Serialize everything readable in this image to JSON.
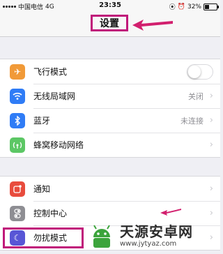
{
  "status_bar": {
    "carrier": "中国电信",
    "network": "4G",
    "time": "23:35",
    "battery_percent": "32%",
    "battery_level": 0.32
  },
  "nav": {
    "title": "设置"
  },
  "group1": [
    {
      "icon": "airplane-icon",
      "label": "飞行模式",
      "control": "toggle",
      "toggle_on": false,
      "color": "#f19a38"
    },
    {
      "icon": "wifi-icon",
      "label": "无线局域网",
      "value": "关闭",
      "color": "#2f7cf6"
    },
    {
      "icon": "bluetooth-icon",
      "label": "蓝牙",
      "value": "未连接",
      "color": "#2f7cf6"
    },
    {
      "icon": "cellular-icon",
      "label": "蜂窝移动网络",
      "value": "",
      "color": "#5cc765"
    }
  ],
  "group2": [
    {
      "icon": "notifications-icon",
      "label": "通知",
      "color": "#e84c3d"
    },
    {
      "icon": "control-center-icon",
      "label": "控制中心",
      "color": "#8e8e93"
    },
    {
      "icon": "moon-icon",
      "label": "勿扰模式",
      "color": "#5856d6"
    }
  ],
  "chevron": "›",
  "watermark": {
    "title": "天源安卓网",
    "url": "www.jytyaz.com"
  },
  "colors": {
    "highlight": "#c0187a",
    "accent_blue": "#2f7cf6"
  }
}
